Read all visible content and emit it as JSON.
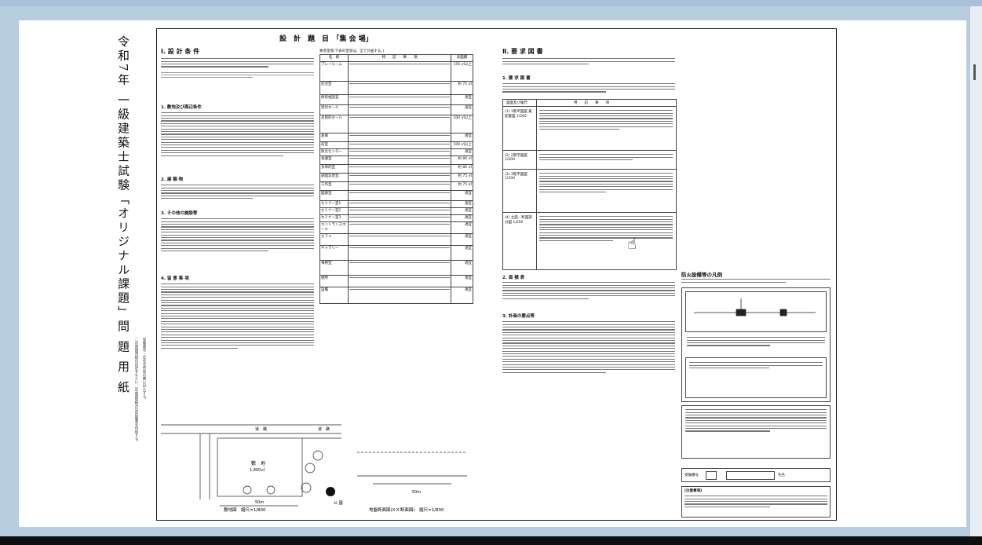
{
  "vertical_title": "令和7年 一級建築士試験「オリジナル課題」問 題 用 紙",
  "sheet": {
    "title": "設　計　題　目　「集 会 場」",
    "section1_title": "Ⅰ. 設 計 条 件",
    "section1_items": [
      "1. 敷地及び周辺条件",
      "2. 建 築 物",
      "3. その他の施設等",
      "4. 留 意 事 項"
    ],
    "table_caption": "要求室等(下表の室等は、全て計画する。)",
    "table_headers": [
      "名　称",
      "特　　記　　事　　項",
      "床面積"
    ],
    "table_rows": [
      [
        "プレイルーム",
        "150 ㎡以上"
      ],
      [
        "託児室",
        "約 75 ㎡"
      ],
      [
        "保育相談室",
        "適宜"
      ],
      [
        "受付ホール",
        "適宜"
      ],
      [
        "多目的ホール",
        "200 ㎡以上"
      ],
      [
        "倉庫",
        "適宜"
      ],
      [
        "前室",
        "200 ㎡以上"
      ],
      [
        "防災センター",
        "適宜"
      ],
      [
        "会議室",
        "約 80 ㎡"
      ],
      [
        "多目的室",
        "約 80 ㎡"
      ],
      [
        "調理実習室",
        "約 75 ㎡"
      ],
      [
        "工作室",
        "約 75 ㎡"
      ],
      [
        "図書室",
        "適宜"
      ],
      [
        "セミナー室1",
        "適宜"
      ],
      [
        "セミナー室2",
        "適宜"
      ],
      [
        "セミナー室3",
        "適宜"
      ],
      [
        "エントランスホール",
        "適宜"
      ],
      [
        "カフェ",
        "適宜"
      ],
      [
        "ギャラリー",
        "適宜"
      ],
      [
        "事務室",
        "適宜"
      ],
      [
        "便所",
        "適宜"
      ],
      [
        "設備",
        "適宜"
      ]
    ],
    "section2_title": "Ⅱ. 要 求 図 書",
    "section2_sub": [
      "1. 要 求 図 書",
      "2. 面 積 表",
      "3. 計画の要点等"
    ],
    "drawing_headers": [
      "図面及び縮尺",
      "特　　記　　事　　項"
    ],
    "drawing_rows": [
      "(1) 1階平面図 兼配置図 1/200",
      "(2) 2階平面図 1/200",
      "(3) 3階平面図 1/200",
      "(4) 立面・断面部分図 1/200"
    ],
    "fire_title": "防火設備等の凡例",
    "site_caption": "敷地図　縮尺=1/800",
    "section_caption": "地盤断面図(X-X′断面図)　縮尺=1/800",
    "site_labels": {
      "road_north": "道　路",
      "road_east": "道　路",
      "site": "敷　地",
      "area": "1,800㎡",
      "width": "50m",
      "depth": "36m",
      "plaza": "公 園",
      "north": "北"
    },
    "exam_no_label": "受験番号",
    "name_label": "氏名",
    "notes_title": "[注意事項]"
  }
}
